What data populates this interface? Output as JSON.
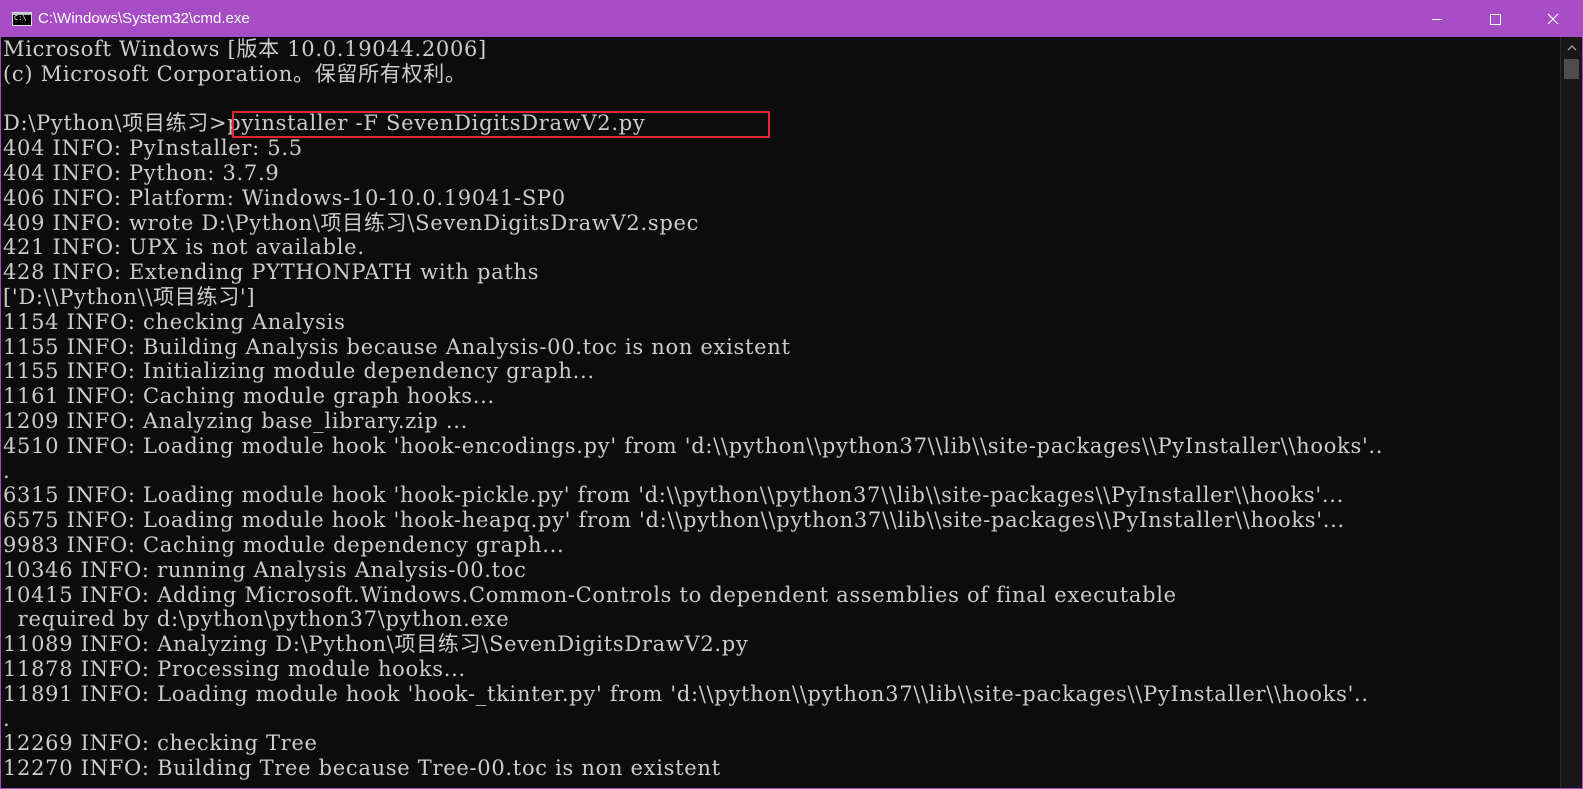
{
  "window": {
    "title": "C:\\Windows\\System32\\cmd.exe",
    "icon_label": "C:\\",
    "icon": "cmd-icon",
    "controls": [
      "minimize-icon",
      "maximize-icon",
      "close-icon"
    ],
    "title_bar_color": "#a64dc6"
  },
  "console": {
    "text_color": "#cccccc",
    "background_color": "#0c0c0c",
    "highlight_color": "#e3262f",
    "lines": [
      "Microsoft Windows [版本 10.0.19044.2006]",
      "(c) Microsoft Corporation。保留所有权利。",
      "",
      "D:\\Python\\项目练习>pyinstaller -F SevenDigitsDrawV2.py",
      "404 INFO: PyInstaller: 5.5",
      "404 INFO: Python: 3.7.9",
      "406 INFO: Platform: Windows-10-10.0.19041-SP0",
      "409 INFO: wrote D:\\Python\\项目练习\\SevenDigitsDrawV2.spec",
      "421 INFO: UPX is not available.",
      "428 INFO: Extending PYTHONPATH with paths",
      "['D:\\\\Python\\\\项目练习']",
      "1154 INFO: checking Analysis",
      "1155 INFO: Building Analysis because Analysis-00.toc is non existent",
      "1155 INFO: Initializing module dependency graph...",
      "1161 INFO: Caching module graph hooks...",
      "1209 INFO: Analyzing base_library.zip ...",
      "4510 INFO: Loading module hook 'hook-encodings.py' from 'd:\\\\python\\\\python37\\\\lib\\\\site-packages\\\\PyInstaller\\\\hooks'..",
      ".",
      "6315 INFO: Loading module hook 'hook-pickle.py' from 'd:\\\\python\\\\python37\\\\lib\\\\site-packages\\\\PyInstaller\\\\hooks'...",
      "6575 INFO: Loading module hook 'hook-heapq.py' from 'd:\\\\python\\\\python37\\\\lib\\\\site-packages\\\\PyInstaller\\\\hooks'...",
      "9983 INFO: Caching module dependency graph...",
      "10346 INFO: running Analysis Analysis-00.toc",
      "10415 INFO: Adding Microsoft.Windows.Common-Controls to dependent assemblies of final executable",
      "  required by d:\\python\\python37\\python.exe",
      "11089 INFO: Analyzing D:\\Python\\项目练习\\SevenDigitsDrawV2.py",
      "11878 INFO: Processing module hooks...",
      "11891 INFO: Loading module hook 'hook-_tkinter.py' from 'd:\\\\python\\\\python37\\\\lib\\\\site-packages\\\\PyInstaller\\\\hooks'..",
      ".",
      "12269 INFO: checking Tree",
      "12270 INFO: Building Tree because Tree-00.toc is non existent"
    ]
  }
}
